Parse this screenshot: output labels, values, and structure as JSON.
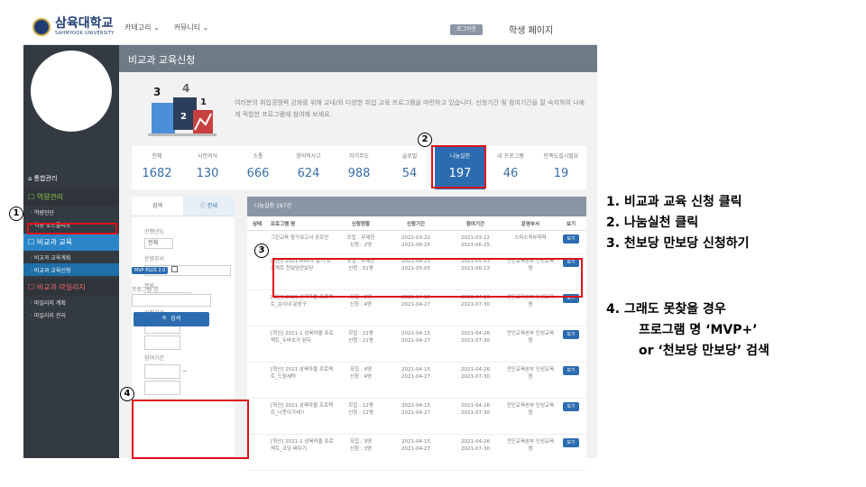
{
  "header": {
    "logo_ko": "삼육대학교",
    "logo_en": "SAHMYOOK UNIVERSITY",
    "nav": [
      "카테고리 ⌄",
      "커뮤니티 ⌄"
    ],
    "logout": "로그아웃",
    "student_page": "학생 페이지"
  },
  "sidebar": {
    "home": "통합관리",
    "sections": [
      {
        "label": "역량관리",
        "color": "green",
        "items": [
          "역량진단",
          "역량 포트폴리오"
        ]
      },
      {
        "label": "비교과 교육",
        "color": "blue",
        "items": [
          "비교과 교육계획",
          "비교과 교육신청"
        ]
      },
      {
        "label": "비교과 마일리지",
        "color": "red",
        "items": [
          "마일리지 계획",
          "마일리지 관리"
        ]
      }
    ]
  },
  "page": {
    "title": "비교과 교육신청",
    "intro": "여러분의 취업경쟁력 강화를 위해 교내/외 다양한 취업 교육 프로그램을 마련하고 있습니다. 신청기간 및 참여기간을 잘 숙지하여 나에게 적합한 프로그램에 참여해 보세요."
  },
  "stats": [
    {
      "label": "전체",
      "value": "1682"
    },
    {
      "label": "시민의식",
      "value": "130"
    },
    {
      "label": "소통",
      "value": "666"
    },
    {
      "label": "창의적사고",
      "value": "624"
    },
    {
      "label": "자기주도",
      "value": "988"
    },
    {
      "label": "글로벌",
      "value": "54"
    },
    {
      "label": "나눔실천",
      "value": "197"
    },
    {
      "label": "내 프로그램",
      "value": "46"
    },
    {
      "label": "만족도설시필요",
      "value": "19"
    }
  ],
  "filter": {
    "tab_search": "검색",
    "tab_info": "ⓘ 안내",
    "year_label": "진행년도",
    "year_value": "전체",
    "dept_label": "운영부서",
    "dept_value": "전체",
    "cat_label": "분류",
    "cat_value": "전체",
    "apply_label": "신청기간",
    "join_label": "참여기간",
    "tilde": "~",
    "mvp_badge": "MVP PLUS 2.0",
    "prog_label": "프로그램 명",
    "search_btn": "🔍 검색"
  },
  "results": {
    "header": "나눔실천 197건",
    "columns": [
      "상태",
      "프로그램 명",
      "신청현황",
      "신청기간",
      "참여기간",
      "운영부서",
      "보기"
    ],
    "rows": [
      {
        "name": "그린교육 참가보고서 공모전",
        "status": [
          "모집 : 무제한",
          "신청 : 2명"
        ],
        "apply": [
          "2021-03-22",
          "2021-06-25"
        ],
        "join": [
          "2021-03-22",
          "2021-06-25"
        ],
        "dept": "스미스학부대학",
        "view": "보기"
      },
      {
        "name": "[혁신] 2021 MVP+ 같기 프로젝트 천보당만보당",
        "status": [
          "모집 : 무제한",
          "신청 : 51명"
        ],
        "apply": [
          "2021-04-23",
          "2021-05-05"
        ],
        "join": [
          "2021-05-03",
          "2021-06-13"
        ],
        "dept": "전인교육본부 인성교육원",
        "view": "보기"
      },
      {
        "name": "[혁신] 2021 삼육마을 프로젝트_순이네 문방구",
        "status": [
          "모집 : 5명",
          "신청 : 4명"
        ],
        "apply": [
          "2021-04-15",
          "2021-04-27"
        ],
        "join": [
          "2021-04-26",
          "2021-07-30"
        ],
        "dept": "전인교육본부 인성교육원",
        "view": "보기"
      },
      {
        "name": "[혁신] 2021-1 삼육마을 프로젝트_두바초가 된다",
        "status": [
          "모집 : 21명",
          "신청 : 21명"
        ],
        "apply": [
          "2021-04-15",
          "2021-04-27"
        ],
        "join": [
          "2021-04-26",
          "2021-07-30"
        ],
        "dept": "전인교육본부 인성교육원",
        "view": "보기"
      },
      {
        "name": "[혁신] 2021 삼육마을 프로젝트_드림세탁",
        "status": [
          "모집 : 4명",
          "신청 : 4명"
        ],
        "apply": [
          "2021-04-15",
          "2021-04-27"
        ],
        "join": [
          "2021-04-26",
          "2021-07-30"
        ],
        "dept": "전인교육본부 인성교육원",
        "view": "보기"
      },
      {
        "name": "[혁신] 2021 삼육마을 프로젝트_나뭇이가세!!",
        "status": [
          "모집 : 12명",
          "신청 : 12명"
        ],
        "apply": [
          "2021-04-15",
          "2021-04-27"
        ],
        "join": [
          "2021-04-26",
          "2021-07-30"
        ],
        "dept": "전인교육본부 인성교육원",
        "view": "보기"
      },
      {
        "name": "[혁신] 2021-1 삼육마을 프로젝트_코딩 배우기",
        "status": [
          "모집 : 3명",
          "신청 : 3명"
        ],
        "apply": [
          "2021-04-15",
          "2021-04-27"
        ],
        "join": [
          "2021-04-26",
          "2021-07-30"
        ],
        "dept": "전인교육본부 인성교육원",
        "view": "보기"
      }
    ]
  },
  "callouts": [
    "1",
    "2",
    "3",
    "4"
  ],
  "instructions": [
    "1. 비교과 교육 신청 클릭",
    "2. 나눔실천 클릭",
    "3. 천보당 만보당 신청하기",
    "4. 그래도 못찾을 경우",
    "프로그램 명 ‘MVP+’",
    "or ‘천보당 만보당’ 검색"
  ],
  "colors": {
    "highlight": "#e0101a",
    "accent": "#2b6cb0",
    "sidebar": "#333a41"
  }
}
